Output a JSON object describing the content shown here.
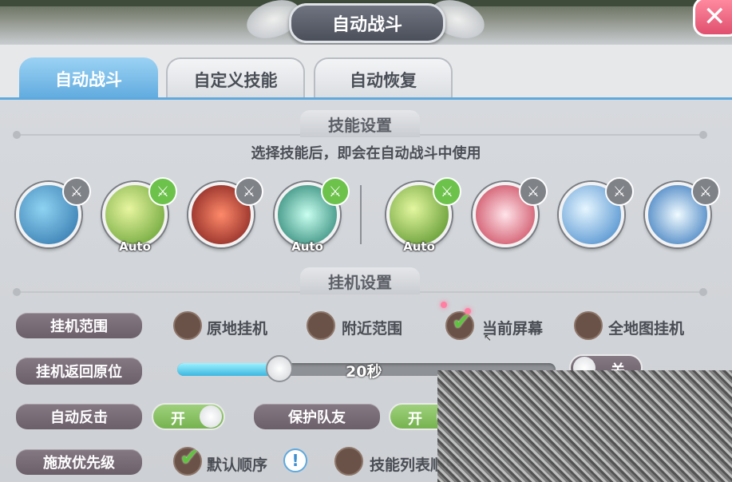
{
  "window": {
    "title": "自动战斗",
    "close_glyph": "✕"
  },
  "tabs": [
    {
      "label": "自动战斗",
      "active": true
    },
    {
      "label": "自定义技能",
      "active": false
    },
    {
      "label": "自动恢复",
      "active": false
    }
  ],
  "skill_section": {
    "heading": "技能设置",
    "subtitle": "选择技能后，即会在自动战斗中使用",
    "skills": [
      {
        "name": "ice-shards",
        "auto": false,
        "badge": "off"
      },
      {
        "name": "lightning",
        "auto": true,
        "badge": "on"
      },
      {
        "name": "fire-figure",
        "auto": false,
        "badge": "off"
      },
      {
        "name": "green-burst",
        "auto": true,
        "badge": "on"
      },
      {
        "name": "green-slash",
        "auto": true,
        "badge": "on"
      },
      {
        "name": "red-beam",
        "auto": false,
        "badge": "off"
      },
      {
        "name": "ice-ground",
        "auto": false,
        "badge": "off"
      },
      {
        "name": "ice-crystal",
        "auto": false,
        "badge": "off"
      }
    ],
    "auto_label": "Auto",
    "badge_glyph": "⚔"
  },
  "idle_section": {
    "heading": "挂机设置",
    "range": {
      "label": "挂机范围",
      "options": [
        "原地挂机",
        "附近范围",
        "当前屏幕",
        "全地图挂机"
      ],
      "selected": "当前屏幕"
    },
    "return": {
      "label": "挂机返回原位",
      "value_text": "20秒",
      "fraction": 0.27,
      "toggle_label": "关",
      "toggle_on": false
    },
    "counter": {
      "label": "自动反击",
      "toggle_label": "开",
      "toggle_on": true
    },
    "protect": {
      "label": "保护队友",
      "toggle_label": "开",
      "toggle_on": true
    },
    "priority": {
      "label": "施放优先级",
      "options": [
        "默认顺序",
        "技能列表顺序"
      ],
      "selected": "默认顺序",
      "info_glyph": "!"
    }
  },
  "colors": {
    "accent": "#5ea9de",
    "check": "#5fc43f",
    "label_bg": "#7a6e79"
  }
}
